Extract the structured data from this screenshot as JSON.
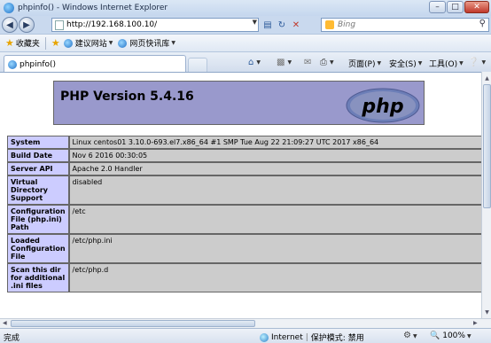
{
  "window": {
    "title": "phpinfo() - Windows Internet Explorer"
  },
  "address": {
    "url": "http://192.168.100.10/"
  },
  "search": {
    "placeholder": "Bing"
  },
  "favorites_bar": {
    "favorites_label": "收藏夹",
    "suggested_sites": "建议网站",
    "web_slice_gallery": "网页快讯库"
  },
  "tab": {
    "title": "phpinfo()"
  },
  "command_bar": {
    "page_menu": "页面(P)",
    "safety_menu": "安全(S)",
    "tools_menu": "工具(O)"
  },
  "php": {
    "version_heading": "PHP Version 5.4.16",
    "logo_text": "php",
    "rows": [
      {
        "key": "System",
        "value": "Linux centos01 3.10.0-693.el7.x86_64 #1 SMP Tue Aug 22 21:09:27 UTC 2017 x86_64"
      },
      {
        "key": "Build Date",
        "value": "Nov 6 2016 00:30:05"
      },
      {
        "key": "Server API",
        "value": "Apache 2.0 Handler"
      },
      {
        "key": "Virtual Directory Support",
        "value": "disabled"
      },
      {
        "key": "Configuration File (php.ini) Path",
        "value": "/etc"
      },
      {
        "key": "Loaded Configuration File",
        "value": "/etc/php.ini"
      },
      {
        "key": "Scan this dir for additional .ini files",
        "value": "/etc/php.d"
      }
    ]
  },
  "status": {
    "done": "完成",
    "zone": "Internet",
    "protected_mode": "保护模式: 禁用",
    "zoom": "100%"
  }
}
